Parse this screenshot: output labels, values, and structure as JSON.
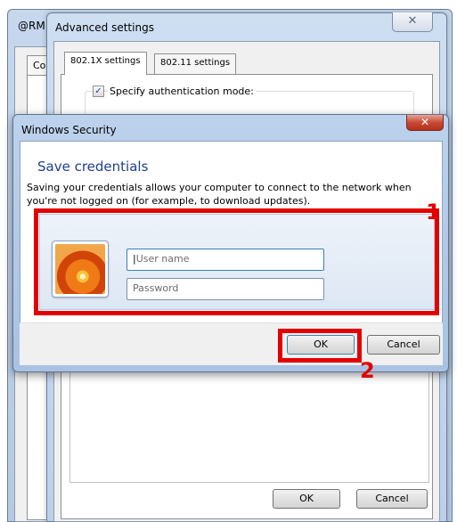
{
  "back_window": {
    "title": "@RM",
    "tab_label": "Co"
  },
  "advanced_settings": {
    "title": "Advanced settings",
    "close_icon": "close-icon",
    "tabs": [
      {
        "label": "802.1X settings",
        "active": true
      },
      {
        "label": "802.11 settings",
        "active": false
      }
    ],
    "specify_auth_label": "Specify authentication mode:",
    "specify_auth_checked": true,
    "ok_label": "OK",
    "cancel_label": "Cancel"
  },
  "windows_security": {
    "title": "Windows Security",
    "close_icon": "close-icon",
    "heading": "Save credentials",
    "description": "Saving your credentials allows your computer to connect to the network when you're not logged on (for example, to download updates).",
    "username_placeholder": "User name",
    "password_placeholder": "Password",
    "ok_label": "OK",
    "cancel_label": "Cancel"
  },
  "annotations": {
    "marker_1": "1",
    "marker_2": "2",
    "color": "#e30000"
  }
}
